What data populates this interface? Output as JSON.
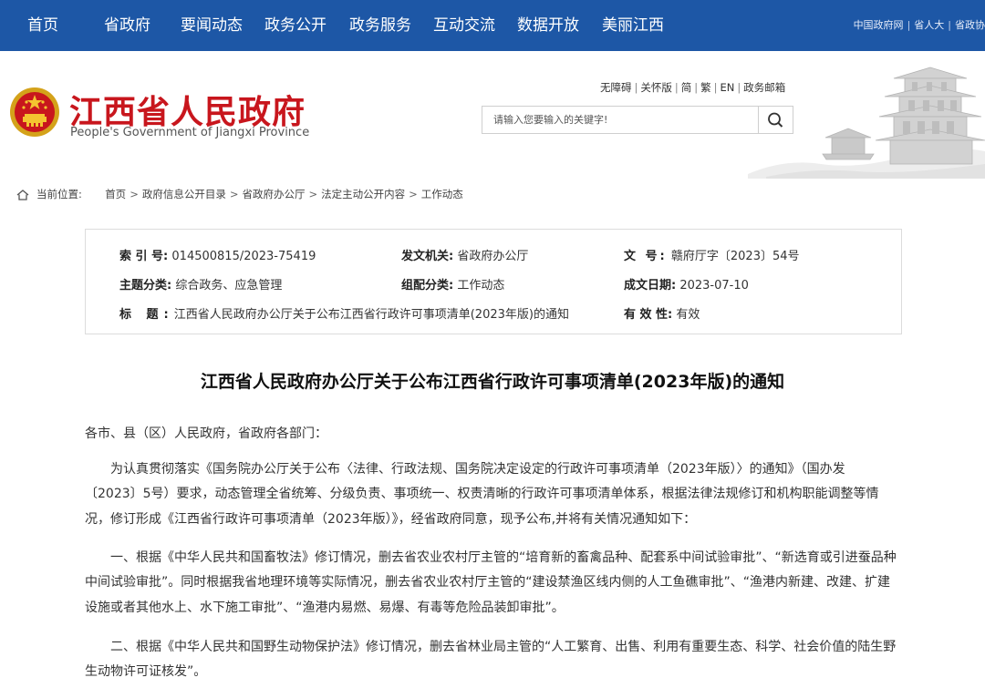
{
  "nav": {
    "items": [
      "首页",
      "省政府",
      "要闻动态",
      "政务公开",
      "政务服务",
      "互动交流",
      "数据开放",
      "美丽江西"
    ],
    "right_links": [
      "中国政府网",
      "省人大",
      "省政协"
    ]
  },
  "header": {
    "title": "江西省人民政府",
    "subtitle": "People's Government of Jiangxi Province",
    "util_links": [
      "无障碍",
      "关怀版",
      "简",
      "繁",
      "EN",
      "政务邮箱"
    ],
    "search_placeholder": "请输入您要输入的关键字!"
  },
  "breadcrumb": {
    "prefix": "当前位置:",
    "items": [
      "首页",
      "政府信息公开目录",
      "省政府办公厅",
      "法定主动公开内容",
      "工作动态"
    ]
  },
  "info": {
    "index_label": "索 引 号:",
    "index_value": "014500815/2023-75419",
    "issuer_label": "发文机关:",
    "issuer_value": "省政府办公厅",
    "docno_label": "文 号:",
    "docno_value": "赣府厅字〔2023〕54号",
    "topic_label": "主题分类:",
    "topic_value": "综合政务、应急管理",
    "category_label": "组配分类:",
    "category_value": "工作动态",
    "date_label": "成文日期:",
    "date_value": "2023-07-10",
    "title_label": "标 题:",
    "title_value": "江西省人民政府办公厅关于公布江西省行政许可事项清单(2023年版)的通知",
    "valid_label": "有 效 性:",
    "valid_value": "有效"
  },
  "document": {
    "title": "江西省人民政府办公厅关于公布江西省行政许可事项清单(2023年版)的通知",
    "greeting": "各市、县（区）人民政府，省政府各部门：",
    "paragraphs": [
      "为认真贯彻落实《国务院办公厅关于公布〈法律、行政法规、国务院决定设定的行政许可事项清单（2023年版）〉的通知》（国办发〔2023〕5号）要求，动态管理全省统筹、分级负责、事项统一、权责清晰的行政许可事项清单体系，根据法律法规修订和机构职能调整等情况，修订形成《江西省行政许可事项清单（2023年版）》，经省政府同意，现予公布,并将有关情况通知如下：",
      "一、根据《中华人民共和国畜牧法》修订情况，删去省农业农村厅主管的“培育新的畜禽品种、配套系中间试验审批”、“新选育或引进蚕品种中间试验审批”。同时根据我省地理环境等实际情况，删去省农业农村厅主管的“建设禁渔区线内侧的人工鱼礁审批”、“渔港内新建、改建、扩建设施或者其他水上、水下施工审批”、“渔港内易燃、易爆、有毒等危险品装卸审批”。",
      "二、根据《中华人民共和国野生动物保护法》修订情况，删去省林业局主管的“人工繁育、出售、利用有重要生态、科学、社会价值的陆生野生动物许可证核发”。"
    ]
  },
  "colors": {
    "nav_bg": "#1d57a6",
    "brand_red": "#c8161d"
  }
}
